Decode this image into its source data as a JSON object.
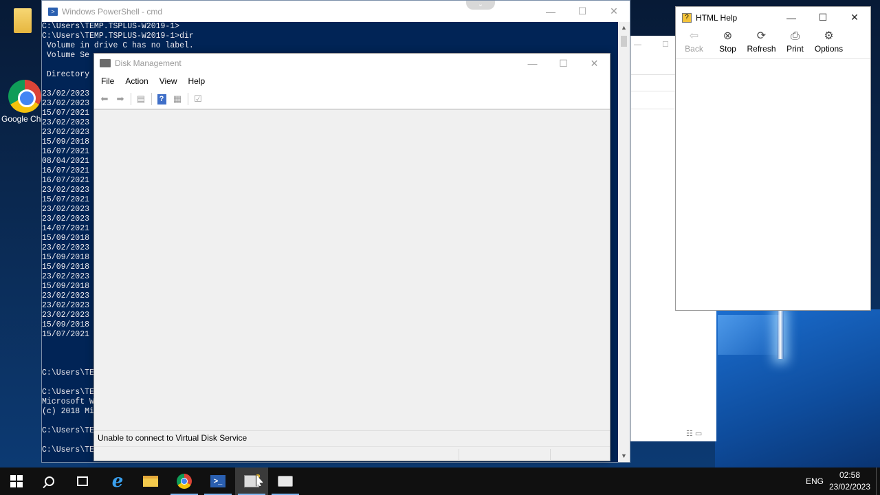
{
  "desktop": {
    "icons": [
      {
        "name": "folder",
        "label": ""
      },
      {
        "name": "google-chrome",
        "label": "Google Ch"
      }
    ]
  },
  "powershell": {
    "title": "Windows PowerShell - cmd",
    "lines": [
      "C:\\Users\\TEMP.TSPLUS-W2019-1>",
      "C:\\Users\\TEMP.TSPLUS-W2019-1>dir",
      " Volume in drive C has no label.",
      " Volume Se",
      "",
      " Directory",
      "",
      "23/02/2023",
      "23/02/2023",
      "15/07/2021",
      "23/02/2023",
      "23/02/2023",
      "15/09/2018",
      "16/07/2021",
      "08/04/2021",
      "16/07/2021",
      "16/07/2021",
      "23/02/2023",
      "15/07/2021",
      "23/02/2023",
      "23/02/2023",
      "14/07/2021",
      "15/09/2018",
      "23/02/2023",
      "15/09/2018",
      "15/09/2018",
      "23/02/2023",
      "15/09/2018",
      "23/02/2023",
      "23/02/2023",
      "23/02/2023",
      "15/09/2018",
      "15/07/2021",
      "",
      "",
      "",
      "C:\\Users\\TE",
      "",
      "C:\\Users\\TE",
      "Microsoft W",
      "(c) 2018 Mi",
      "",
      "C:\\Users\\TE",
      "",
      "C:\\Users\\TE"
    ]
  },
  "disk_management": {
    "title": "Disk Management",
    "menu": [
      "File",
      "Action",
      "View",
      "Help"
    ],
    "status": "Unable to connect to Virtual Disk Service"
  },
  "html_help": {
    "title": "HTML Help",
    "toolbar": [
      {
        "label": "Back",
        "icon": "back-arrow-icon",
        "enabled": false
      },
      {
        "label": "Stop",
        "icon": "stop-icon",
        "enabled": true
      },
      {
        "label": "Refresh",
        "icon": "refresh-icon",
        "enabled": true
      },
      {
        "label": "Print",
        "icon": "print-icon",
        "enabled": true
      },
      {
        "label": "Options",
        "icon": "options-icon",
        "enabled": true
      }
    ]
  },
  "taskbar": {
    "items": [
      "start",
      "search",
      "task-view",
      "internet-explorer",
      "file-explorer",
      "google-chrome",
      "powershell",
      "html-help",
      "disk-management"
    ],
    "language": "ENG",
    "time": "02:58",
    "date": "23/02/2023"
  }
}
